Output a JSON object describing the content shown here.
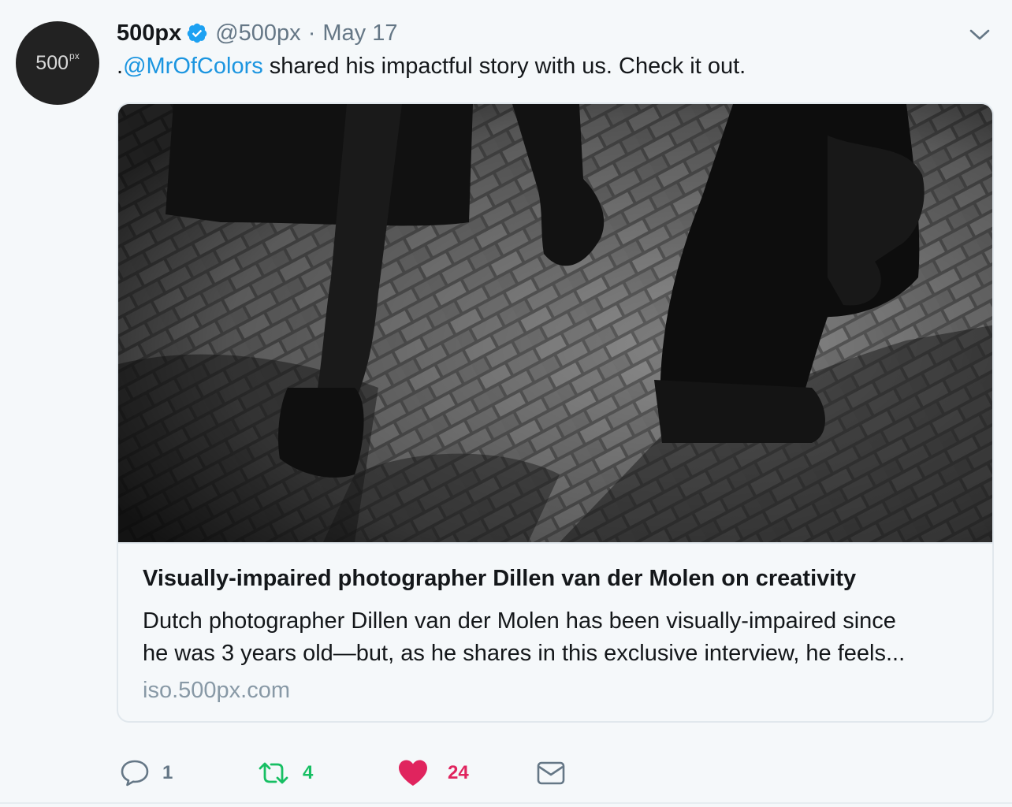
{
  "tweet": {
    "avatar_text": "500",
    "avatar_sup": "px",
    "name": "500px",
    "handle": "@500px",
    "separator": "·",
    "date": "May 17",
    "text_prefix": ".",
    "mention": "@MrOfColors",
    "text_rest": " shared his impactful story with us. Check it out."
  },
  "card": {
    "title": "Visually-impaired photographer Dillen van der Molen on creativity",
    "description_line1": "Dutch photographer Dillen van der Molen has been visually-impaired since",
    "description_line2": "he was 3 years old—but, as he shares in this exclusive interview, he feels...",
    "domain": "iso.500px.com"
  },
  "actions": {
    "reply_count": "1",
    "retweet_count": "4",
    "like_count": "24"
  },
  "colors": {
    "link": "#1b95e0",
    "retweet": "#17bf63",
    "like": "#e0245e",
    "muted": "#657786",
    "verified": "#1da1f2"
  },
  "icons": {
    "verified": "verified-badge-icon",
    "caret": "chevron-down-icon",
    "reply": "reply-icon",
    "retweet": "retweet-icon",
    "like": "heart-icon",
    "dm": "envelope-icon"
  }
}
